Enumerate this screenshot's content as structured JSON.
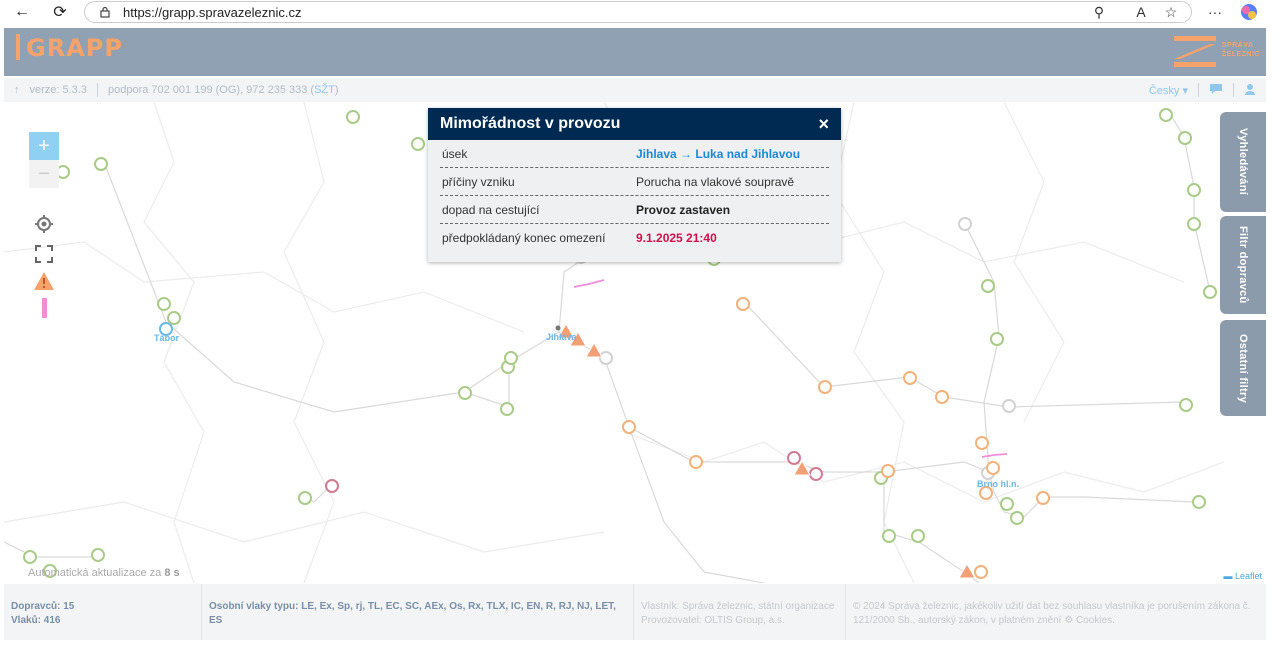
{
  "browser": {
    "url": "https://grapp.spravazeleznic.cz"
  },
  "header": {
    "logo": "GRAPP",
    "brand_line1": "SPRÁVA",
    "brand_line2": "ŽELEZNIC"
  },
  "subbar": {
    "version": "verze: 5.3.3",
    "support": "podpora 702 001 199 (OG), 972 235 333 (",
    "support_szt": "SŽT",
    "support_end": ")",
    "language": "Česky"
  },
  "map": {
    "zoom_in": "+",
    "zoom_out": "−",
    "cities": [
      "Tábor",
      "Jihlava",
      "Brno hl.n."
    ],
    "auto_update_label": "Automatická aktualizace za ",
    "auto_update_value": "8 s",
    "attribution": "Leaflet",
    "side_tabs": [
      "Vyhledávání",
      "Filtr dopravců",
      "Ostatní filtry"
    ]
  },
  "popup": {
    "title": "Mimořádnost v provozu",
    "close": "×",
    "rows": [
      {
        "label": "úsek",
        "value": "Jihlava → Luka nad Jihlavou"
      },
      {
        "label": "příčiny vzniku",
        "value": "Porucha na vlakové soupravě"
      },
      {
        "label": "dopad na cestující",
        "value": "Provoz zastaven"
      },
      {
        "label": "předpokládaný konec omezení",
        "value": "9.1.2025 21:40"
      }
    ]
  },
  "footer": {
    "carriers": "Dopravců: 15",
    "trains": "Vlaků: 416",
    "train_types": "Osobní vlaky typu: LE, Ex, Sp, rj, TL, EC, SC, AEx, Os, Rx, TLX, IC, EN, R, RJ, NJ, LET, ES",
    "owner": "Vlastník: Správa železnic, státní organizace",
    "operator": "Provozovatel: OLTIS Group, a.s.",
    "copyright": "© 2024 Správa železnic, jakékoliv užití dat bez souhlasu vlastníka je porušením zákona č. 121/2000 Sb., autorský zákon, v platném znění",
    "cookies": "Cookies."
  },
  "colors": {
    "header_bg": "#8fa1b3",
    "logo": "#f5a36b",
    "popup_head": "#002a52",
    "link": "#1e88d6",
    "deadline": "#d0104a",
    "train_green": "#8dc26b",
    "train_orange": "#f2b27a",
    "warning": "#f29f75"
  }
}
